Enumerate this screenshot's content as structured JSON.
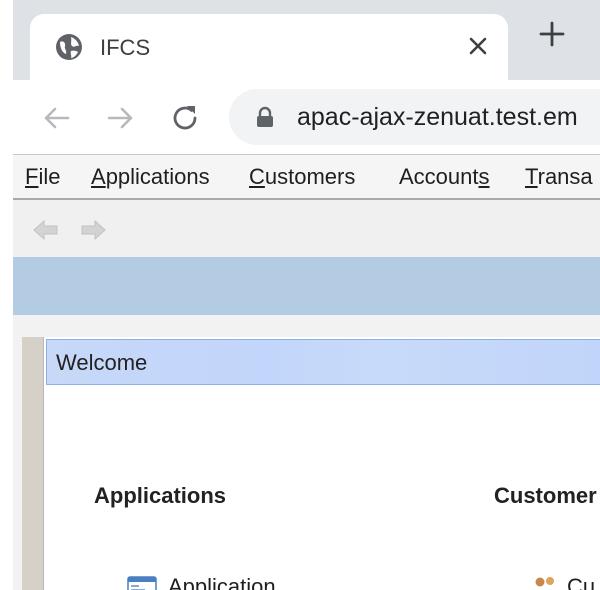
{
  "browser": {
    "tab": {
      "title": "IFCS",
      "favicon": "globe-icon"
    },
    "new_tab_label": "+",
    "address": {
      "url": "apac-ajax-zenuat.test.em"
    }
  },
  "menubar": {
    "items": [
      {
        "label": "File",
        "mnemonic_index": 0
      },
      {
        "label": "Applications",
        "mnemonic_index": 0
      },
      {
        "label": "Customers",
        "mnemonic_index": 0
      },
      {
        "label": "Accounts",
        "mnemonic_index": 7
      },
      {
        "label": "Transa",
        "mnemonic_index": 0
      }
    ]
  },
  "main": {
    "welcome_title": "Welcome",
    "sections": [
      {
        "title": "Applications",
        "first_link": "Application",
        "icon": "application-window-icon"
      },
      {
        "title": "Customer",
        "first_link": "Cu",
        "icon": "customers-people-icon"
      }
    ]
  },
  "colors": {
    "tabstrip": "#dee1e6",
    "bluebar": "#b4cce3",
    "welcome_bar": "#c4d8fa"
  }
}
